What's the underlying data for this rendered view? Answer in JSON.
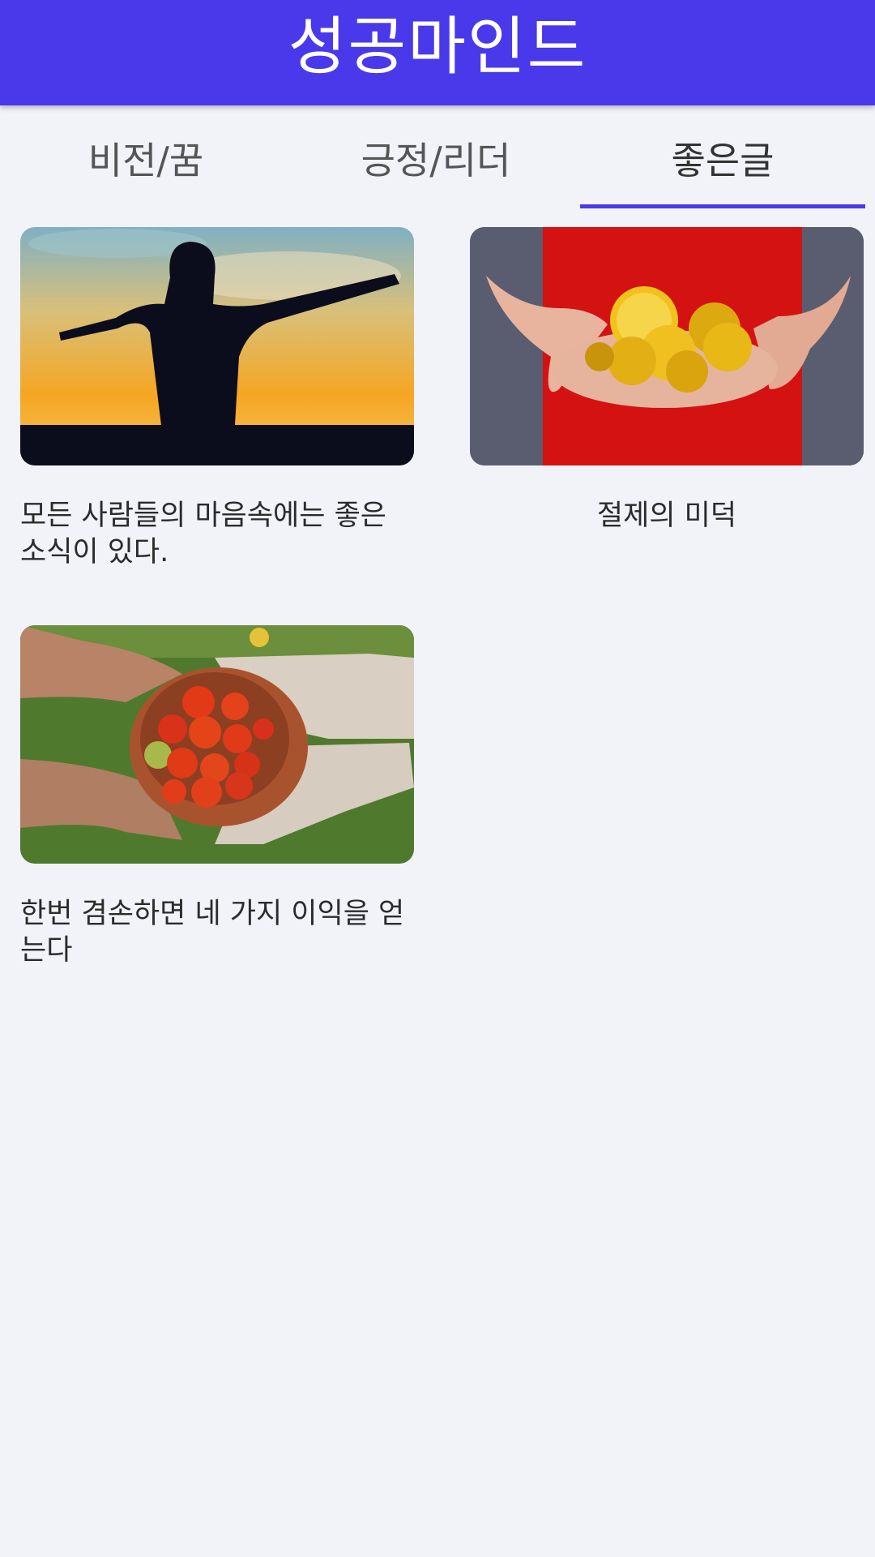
{
  "app_bar": {
    "title": "성공마인드"
  },
  "tabs": [
    {
      "label": "비전/꿈",
      "active": false
    },
    {
      "label": "긍정/리더",
      "active": false
    },
    {
      "label": "좋은글",
      "active": true
    }
  ],
  "cards": [
    {
      "caption": "모든 사람들의 마음속에는 좋은 소식이 있다.",
      "image": "silhouette-sunset-photo"
    },
    {
      "caption": "절제의 미덕",
      "image": "gold-coins-in-hands-photo"
    },
    {
      "caption": "한번 겸손하면 네 가지 이익을 얻는다",
      "image": "tomatoes-bowl-hands-photo"
    }
  ],
  "colors": {
    "primary": "#4a39ea",
    "background": "#f1f3f9"
  }
}
